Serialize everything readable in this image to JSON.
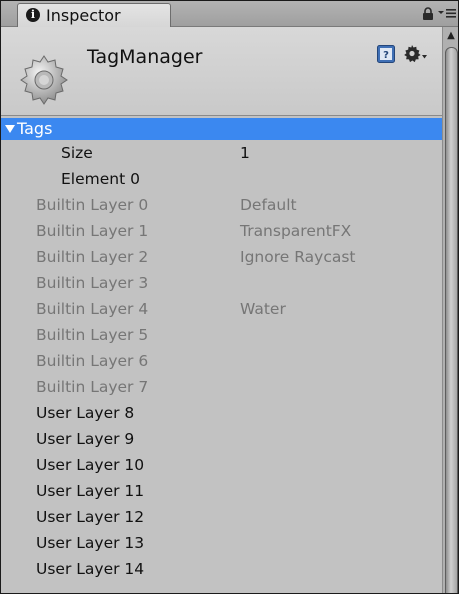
{
  "tab": {
    "label": "Inspector",
    "info_glyph": "i"
  },
  "header": {
    "object_name": "TagManager",
    "icon": "gear-icon"
  },
  "tags": {
    "label": "Tags",
    "size_label": "Size",
    "size_value": "1",
    "element_label": "Element 0"
  },
  "builtin_layers": [
    {
      "label": "Builtin Layer 0",
      "value": "Default"
    },
    {
      "label": "Builtin Layer 1",
      "value": "TransparentFX"
    },
    {
      "label": "Builtin Layer 2",
      "value": "Ignore Raycast"
    },
    {
      "label": "Builtin Layer 3",
      "value": ""
    },
    {
      "label": "Builtin Layer 4",
      "value": "Water"
    },
    {
      "label": "Builtin Layer 5",
      "value": ""
    },
    {
      "label": "Builtin Layer 6",
      "value": ""
    },
    {
      "label": "Builtin Layer 7",
      "value": ""
    }
  ],
  "user_layers": [
    {
      "label": "User Layer 8"
    },
    {
      "label": "User Layer 9"
    },
    {
      "label": "User Layer 10"
    },
    {
      "label": "User Layer 11"
    },
    {
      "label": "User Layer 12"
    },
    {
      "label": "User Layer 13"
    },
    {
      "label": "User Layer 14"
    }
  ],
  "colors": {
    "selection": "#3b88f0",
    "panel": "#c2c2c2",
    "dim_text": "#767676"
  }
}
